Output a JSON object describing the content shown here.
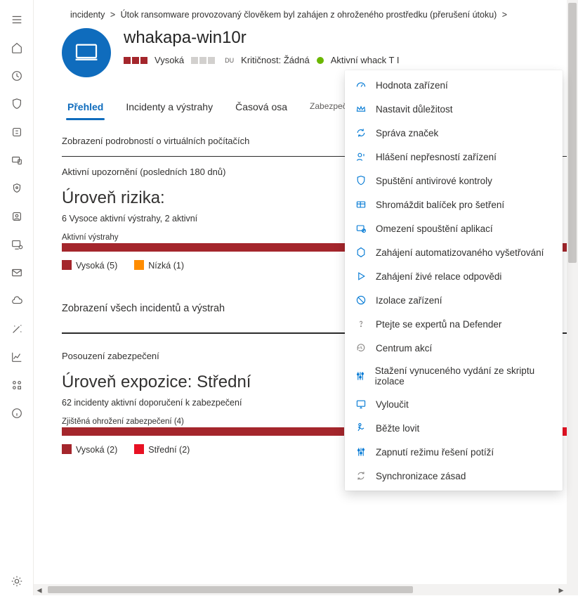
{
  "breadcrumbs": {
    "items": [
      "incidenty",
      "Útok ransomware provozovaný člověkem byl zahájen z ohroženého prostředku (přerušení útoku)"
    ],
    "sep": "&gt;"
  },
  "device": {
    "name": "whakapa-win10r",
    "severity_label": "Vysoká",
    "du_tag": "DU",
    "criticality_label": "Kritičnost: Žádná",
    "active_label": "Aktivní whack T I"
  },
  "tabs": [
    "Přehled",
    "Incidenty a výstrahy",
    "Časová osa",
    "Zabezpečení"
  ],
  "active_tab": 0,
  "overview": {
    "vm_detail": "Zobrazení podrobností o virtuálních počítačích",
    "active_alerts_title": "Aktivní upozornění (posledních 180 dnů)",
    "risk_title": "Úroveň rizika:",
    "risk_count_line_a": "6",
    "risk_count_line_b": "Vysoce aktivní výstrahy, 2 aktivní",
    "alerts_bar_label": "Aktivní výstrahy",
    "legend_high": "Vysoká (5)",
    "legend_low": "Nízká (1)",
    "view_all": "Zobrazení všech incidentů a výstrah",
    "assessment_label": "Posouzení zabezpečení",
    "exposure_title": "Úroveň expozice: Střední",
    "exposure_count_a": "62",
    "exposure_count_b": "incidenty aktivní doporučení k zabezpečení",
    "vuln_bar_label": "Zjištěná ohrožení zabezpečení (4)",
    "vuln_legend_high": "Vysoká (2)",
    "vuln_legend_med": "Střední (2)"
  },
  "menu": {
    "items": [
      {
        "icon": "gauge",
        "label": "Hodnota zařízení"
      },
      {
        "icon": "crown",
        "label": "Nastavit důležitost"
      },
      {
        "icon": "refresh",
        "label": "Správa značek"
      },
      {
        "icon": "person-alert",
        "label": "Hlášení nepřesností zařízení"
      },
      {
        "icon": "shield",
        "label": "Spuštění antivirové kontroly"
      },
      {
        "icon": "package",
        "label": "Shromáždit balíček pro šetření"
      },
      {
        "icon": "appblock",
        "label": "Omezení spouštění aplikací"
      },
      {
        "icon": "hex",
        "label": "Zahájení automatizovaného vyšetřování"
      },
      {
        "icon": "play",
        "label": "Zahájení živé relace odpovědi"
      },
      {
        "icon": "isolate",
        "label": "Izolace zařízení"
      },
      {
        "icon": "question",
        "label": "Ptejte se expertů na Defender",
        "grey": true
      },
      {
        "icon": "history",
        "label": "Centrum akcí",
        "grey": true
      },
      {
        "icon": "sliders",
        "label": "Stažení vynuceného vydání ze skriptu izolace"
      },
      {
        "icon": "monitor",
        "label": "Vyloučit"
      },
      {
        "icon": "run",
        "label": "Běžte lovit"
      },
      {
        "icon": "sliders",
        "label": "Zapnutí režimu řešení potíží"
      },
      {
        "icon": "sync",
        "label": "Synchronizace zásad",
        "grey": true
      }
    ]
  },
  "colors": {
    "red": "#a4262c",
    "orange": "#ff8c00",
    "brightred": "#d13438",
    "brand": "#0f6cbd"
  }
}
